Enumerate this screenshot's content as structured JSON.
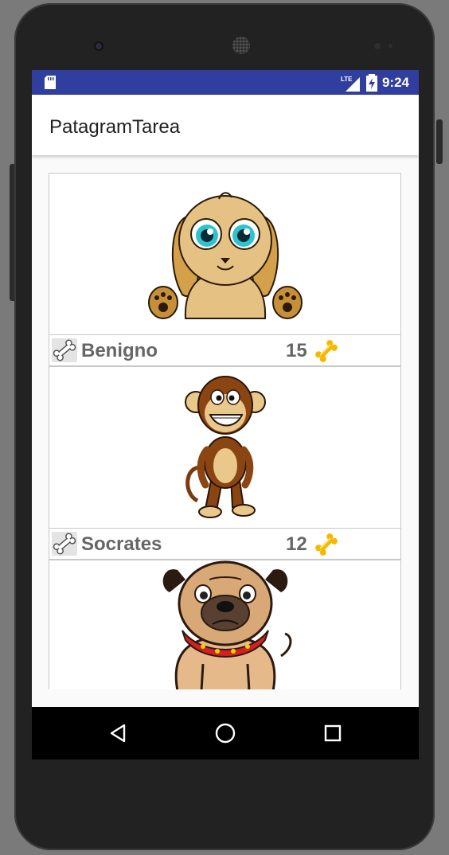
{
  "status_bar": {
    "network_label": "LTE",
    "time": "9:24"
  },
  "app_bar": {
    "title": "PatagramTarea"
  },
  "pets": [
    {
      "name": "Benigno",
      "likes": "15",
      "image": "puppy-illustration"
    },
    {
      "name": "Socrates",
      "likes": "12",
      "image": "monkey-illustration"
    },
    {
      "name": "",
      "likes": "",
      "image": "pug-illustration"
    }
  ],
  "colors": {
    "status_bar": "#303f9f",
    "app_bar": "#ffffff",
    "text_secondary": "#666666",
    "bone_gold": "#f5b800"
  },
  "nav_icons": [
    "back-icon",
    "home-icon",
    "recents-icon"
  ]
}
